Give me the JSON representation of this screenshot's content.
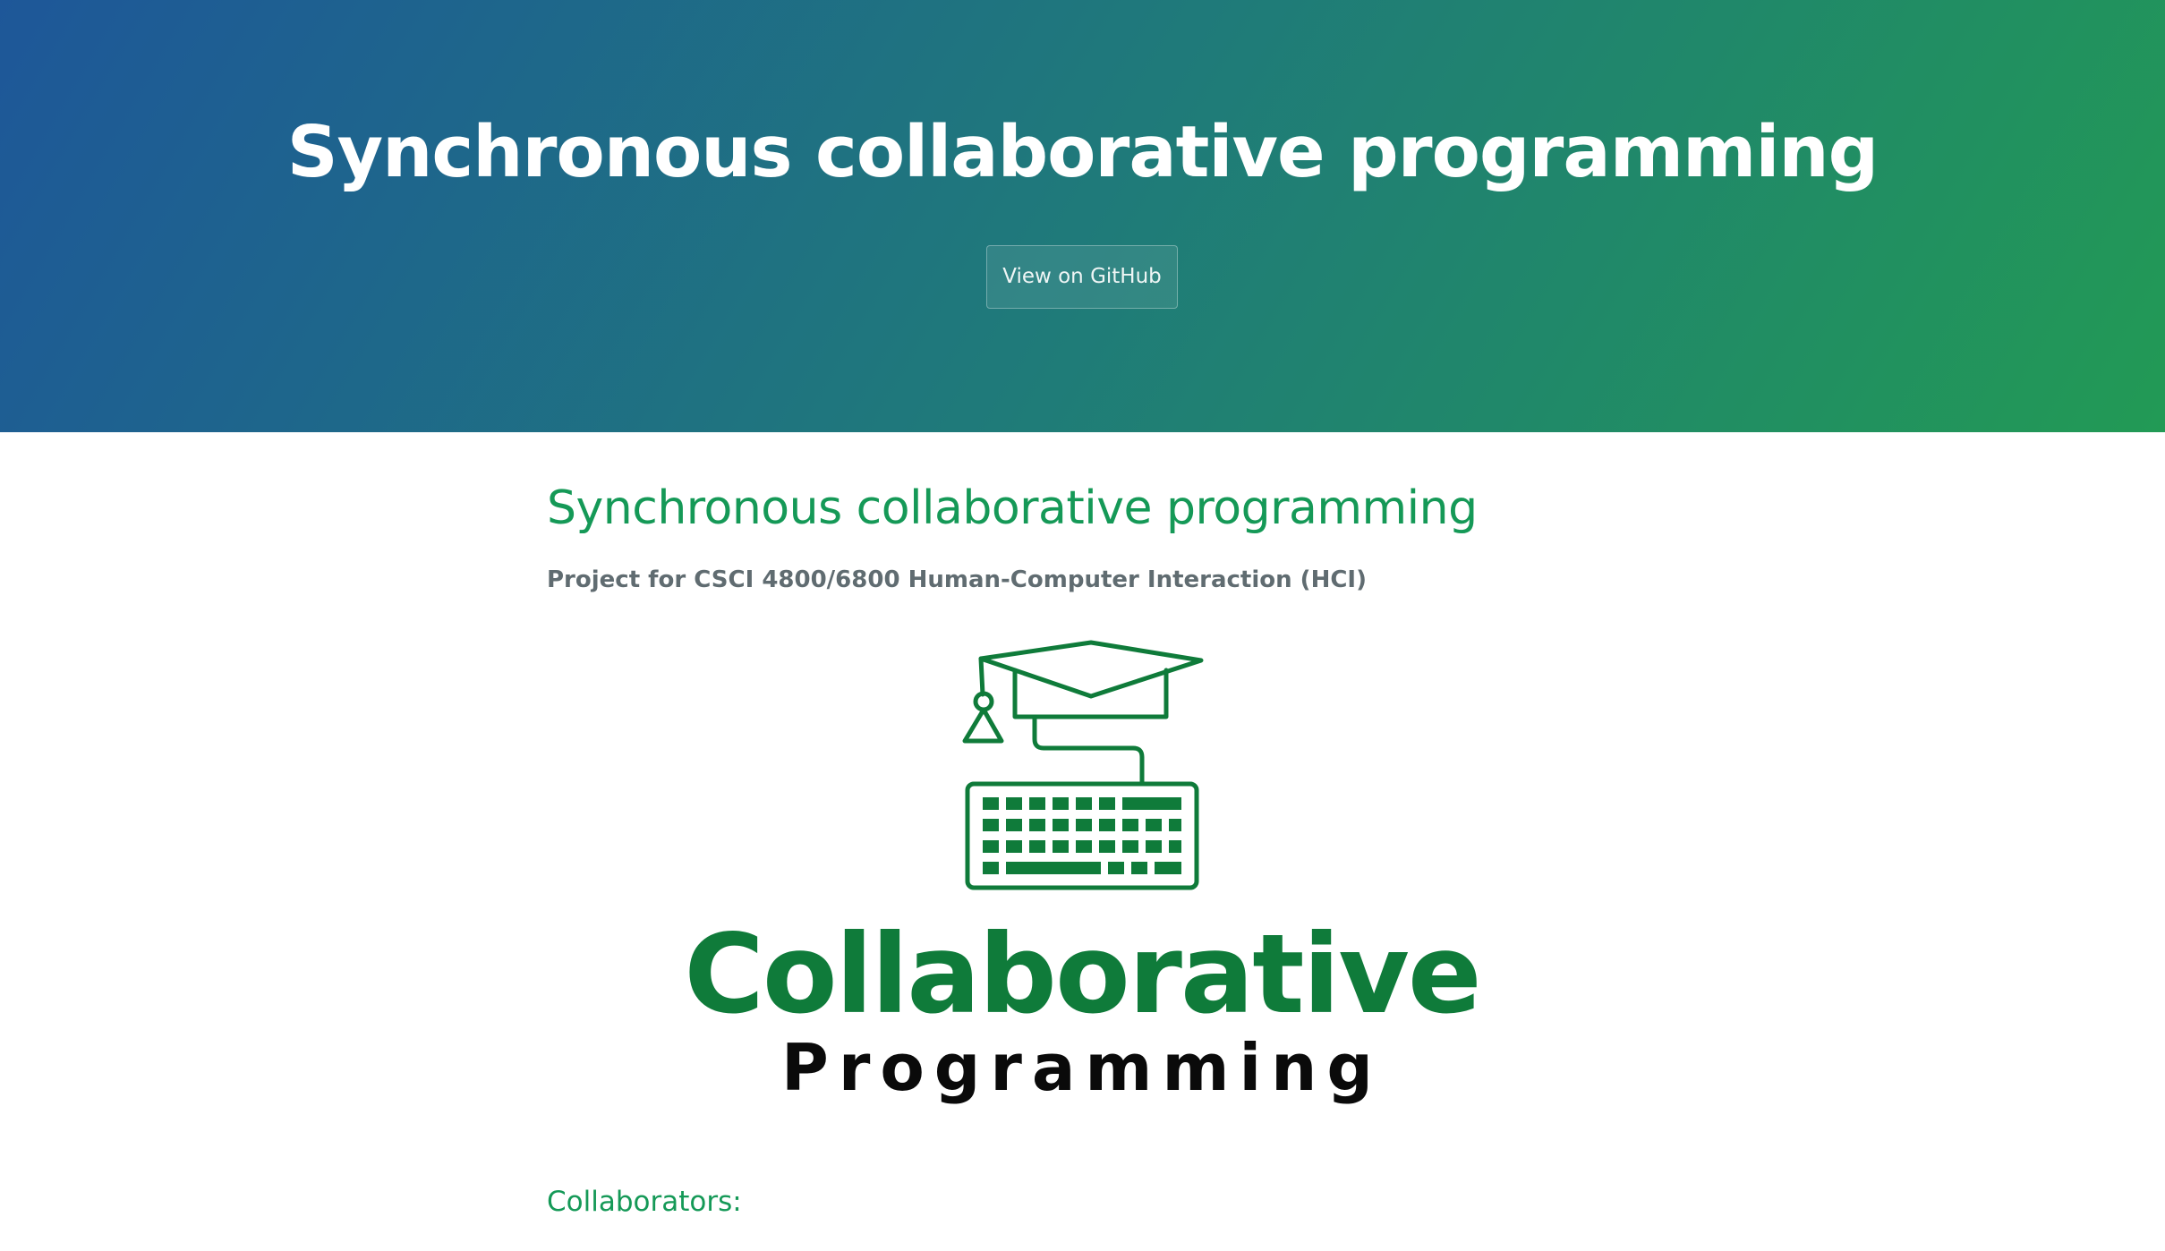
{
  "header": {
    "project_name": "Synchronous collaborative programming",
    "github_button": "View on GitHub"
  },
  "main": {
    "title": "Synchronous collaborative programming",
    "subtitle": "Project for CSCI 4800/6800 Human-Computer Interaction (HCI)",
    "logo": {
      "word_1": "Collaborative",
      "word_2": "Programming",
      "icon": "graduation-cap-keyboard-icon"
    },
    "collaborators_heading": "Collaborators:"
  },
  "colors": {
    "header_gradient_start": "#1e5799",
    "header_gradient_end": "#229a55",
    "heading_green": "#159957",
    "logo_green": "#0f7b3a",
    "subtitle_gray": "#606c71"
  }
}
